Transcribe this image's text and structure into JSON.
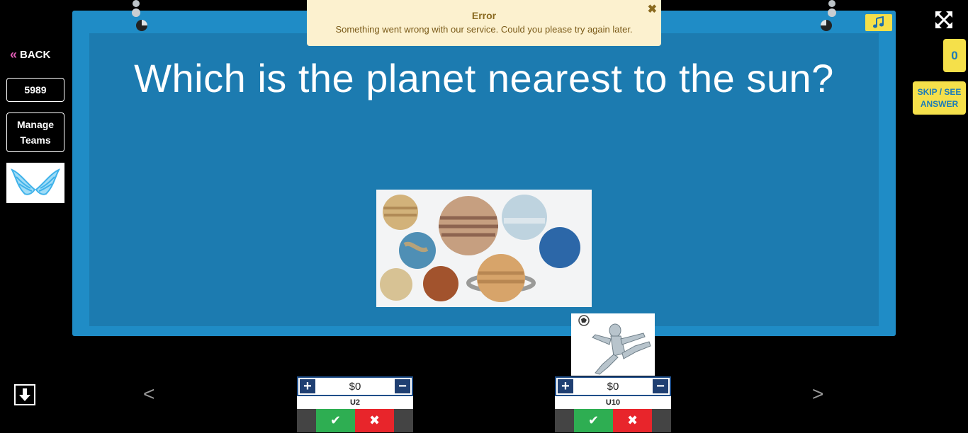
{
  "nav": {
    "back_label": "BACK",
    "game_code": "5989",
    "manage_teams_label": "Manage\nTeams"
  },
  "toast": {
    "title": "Error",
    "message": "Something went wrong with our service. Could you please try again later.",
    "close_glyph": "✖"
  },
  "question": {
    "text": "Which is the planet nearest to the sun?"
  },
  "side": {
    "score": "0",
    "skip_label": "SKIP / SEE ANSWER"
  },
  "navigation": {
    "prev_glyph": "<",
    "next_glyph": ">"
  },
  "teams": [
    {
      "amount": "$0",
      "name": "U2"
    },
    {
      "amount": "$0",
      "name": "U10"
    }
  ],
  "colors": {
    "board": "#1f8cc6",
    "board_inner": "#1c7bb0",
    "accent": "#f5e04a",
    "toast_bg": "#fcf1cf",
    "correct": "#2eae52",
    "wrong": "#e8252b"
  },
  "icons": [
    "back-chevron-icon",
    "music-note-icon",
    "fullscreen-icon",
    "download-arrow-icon",
    "plus-icon",
    "minus-icon",
    "check-icon",
    "close-x-icon"
  ]
}
